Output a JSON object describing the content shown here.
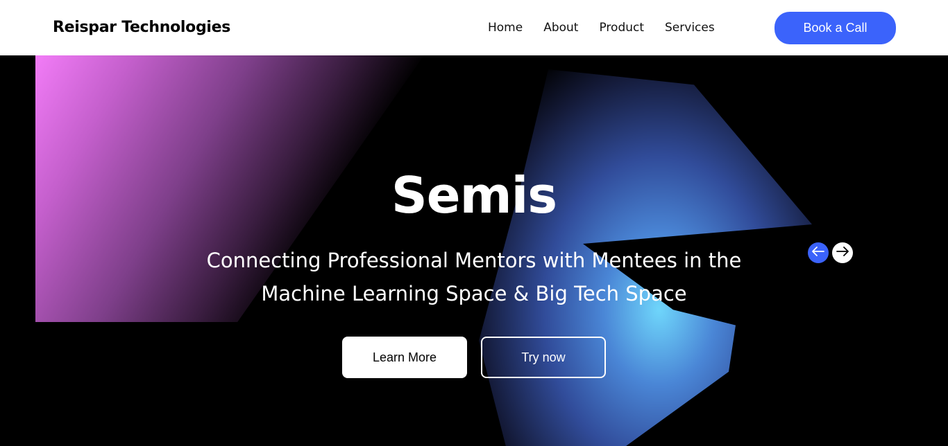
{
  "header": {
    "brand": "Reispar Technologies",
    "nav": [
      {
        "label": "Home"
      },
      {
        "label": "About"
      },
      {
        "label": "Product"
      },
      {
        "label": "Services"
      }
    ],
    "cta_label": "Book a Call"
  },
  "hero": {
    "title": "Semis",
    "subtitle": "Connecting Professional Mentors with Mentees in the Machine Learning Space & Big Tech Space",
    "primary_button": "Learn More",
    "secondary_button": "Try now",
    "carousel": {
      "prev_icon": "arrow-left-icon",
      "next_icon": "arrow-right-icon"
    }
  },
  "colors": {
    "accent": "#3b63fb",
    "background": "#000000",
    "navbar": "#ffffff",
    "gradient_pink": "#f27cf7",
    "gradient_blue": "#6fd6fb"
  }
}
